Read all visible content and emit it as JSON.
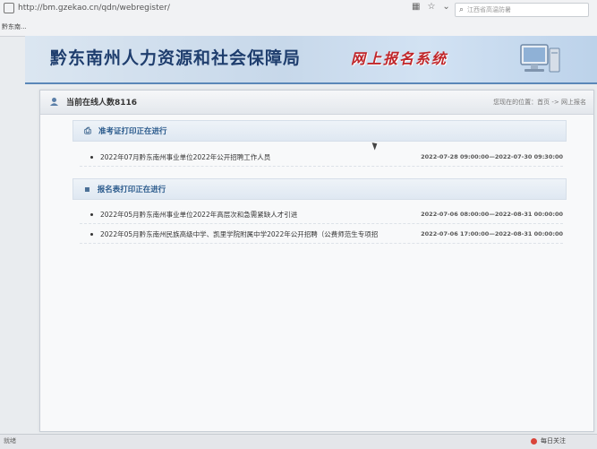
{
  "browser": {
    "url": "http://bm.gzekao.cn/qdn/webregister/",
    "search_placeholder": "江西省高温防暑",
    "tab_label": "黔东南..."
  },
  "header": {
    "site_title": "黔东南州人力资源和社会保障局",
    "system_title": "网上报名系统"
  },
  "panel": {
    "online_label": "当前在线人数8116",
    "breadcrumb": "您现在的位置：首页 -> 网上报名"
  },
  "sections": [
    {
      "title": "准考证打印正在进行",
      "rows": [
        {
          "job": "2022年07月黔东南州事业单位2022年公开招聘工作人员",
          "period": "2022-07-28 09:00:00—2022-07-30 09:30:00"
        }
      ]
    },
    {
      "title": "报名表打印正在进行",
      "rows": [
        {
          "job": "2022年05月黔东南州事业单位2022年高层次和急需紧缺人才引进",
          "period": "2022-07-06 08:00:00—2022-08-31 00:00:00"
        },
        {
          "job": "2022年05月黔东南州民族高级中学、凯里学院附属中学2022年公开招聘（公费师范生专项招",
          "period": "2022-07-06 17:00:00—2022-08-31 00:00:00"
        }
      ]
    }
  ],
  "footer": {
    "status": "就绪",
    "follow_label": "每日关注"
  },
  "colors": {
    "brand_blue": "#1f3e6e",
    "system_red": "#c0262a",
    "section_blue": "#2a5a8c"
  }
}
